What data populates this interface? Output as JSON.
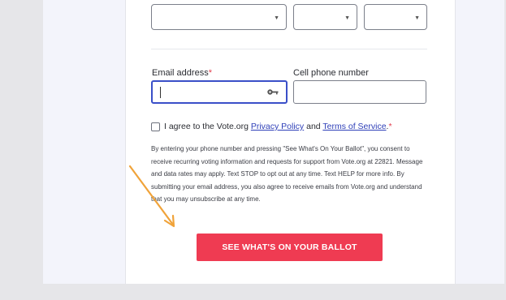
{
  "form": {
    "email_label": "Email address",
    "email_required_mark": "*",
    "email_value": "",
    "phone_label": "Cell phone number",
    "phone_value": "",
    "agree_prefix": "I agree to the Vote.org ",
    "privacy_link": "Privacy Policy",
    "agree_and": " and ",
    "terms_link": "Terms of Service",
    "agree_suffix": ".",
    "agree_required_mark": "*",
    "disclaimer": "By entering your phone number and pressing \"See What's On Your Ballot\", you consent to receive recurring voting information and requests for support from Vote.org at 22821. Message and data rates may apply. Text STOP to opt out at any time. Text HELP for more info. By submitting your email address, you also agree to receive emails from Vote.org and understand that you may unsubscribe at any time.",
    "submit_label": "SEE WHAT'S ON YOUR BALLOT"
  },
  "icons": {
    "dropdown": "chevron-down-icon",
    "password_manager": "key-icon",
    "annotation": "arrow-annotation"
  },
  "colors": {
    "cta": "#ef3b52",
    "focus_border": "#3a4fc8",
    "link": "#2e3fb8",
    "required": "#e23c4c",
    "annotation_arrow": "#f0a33a"
  }
}
